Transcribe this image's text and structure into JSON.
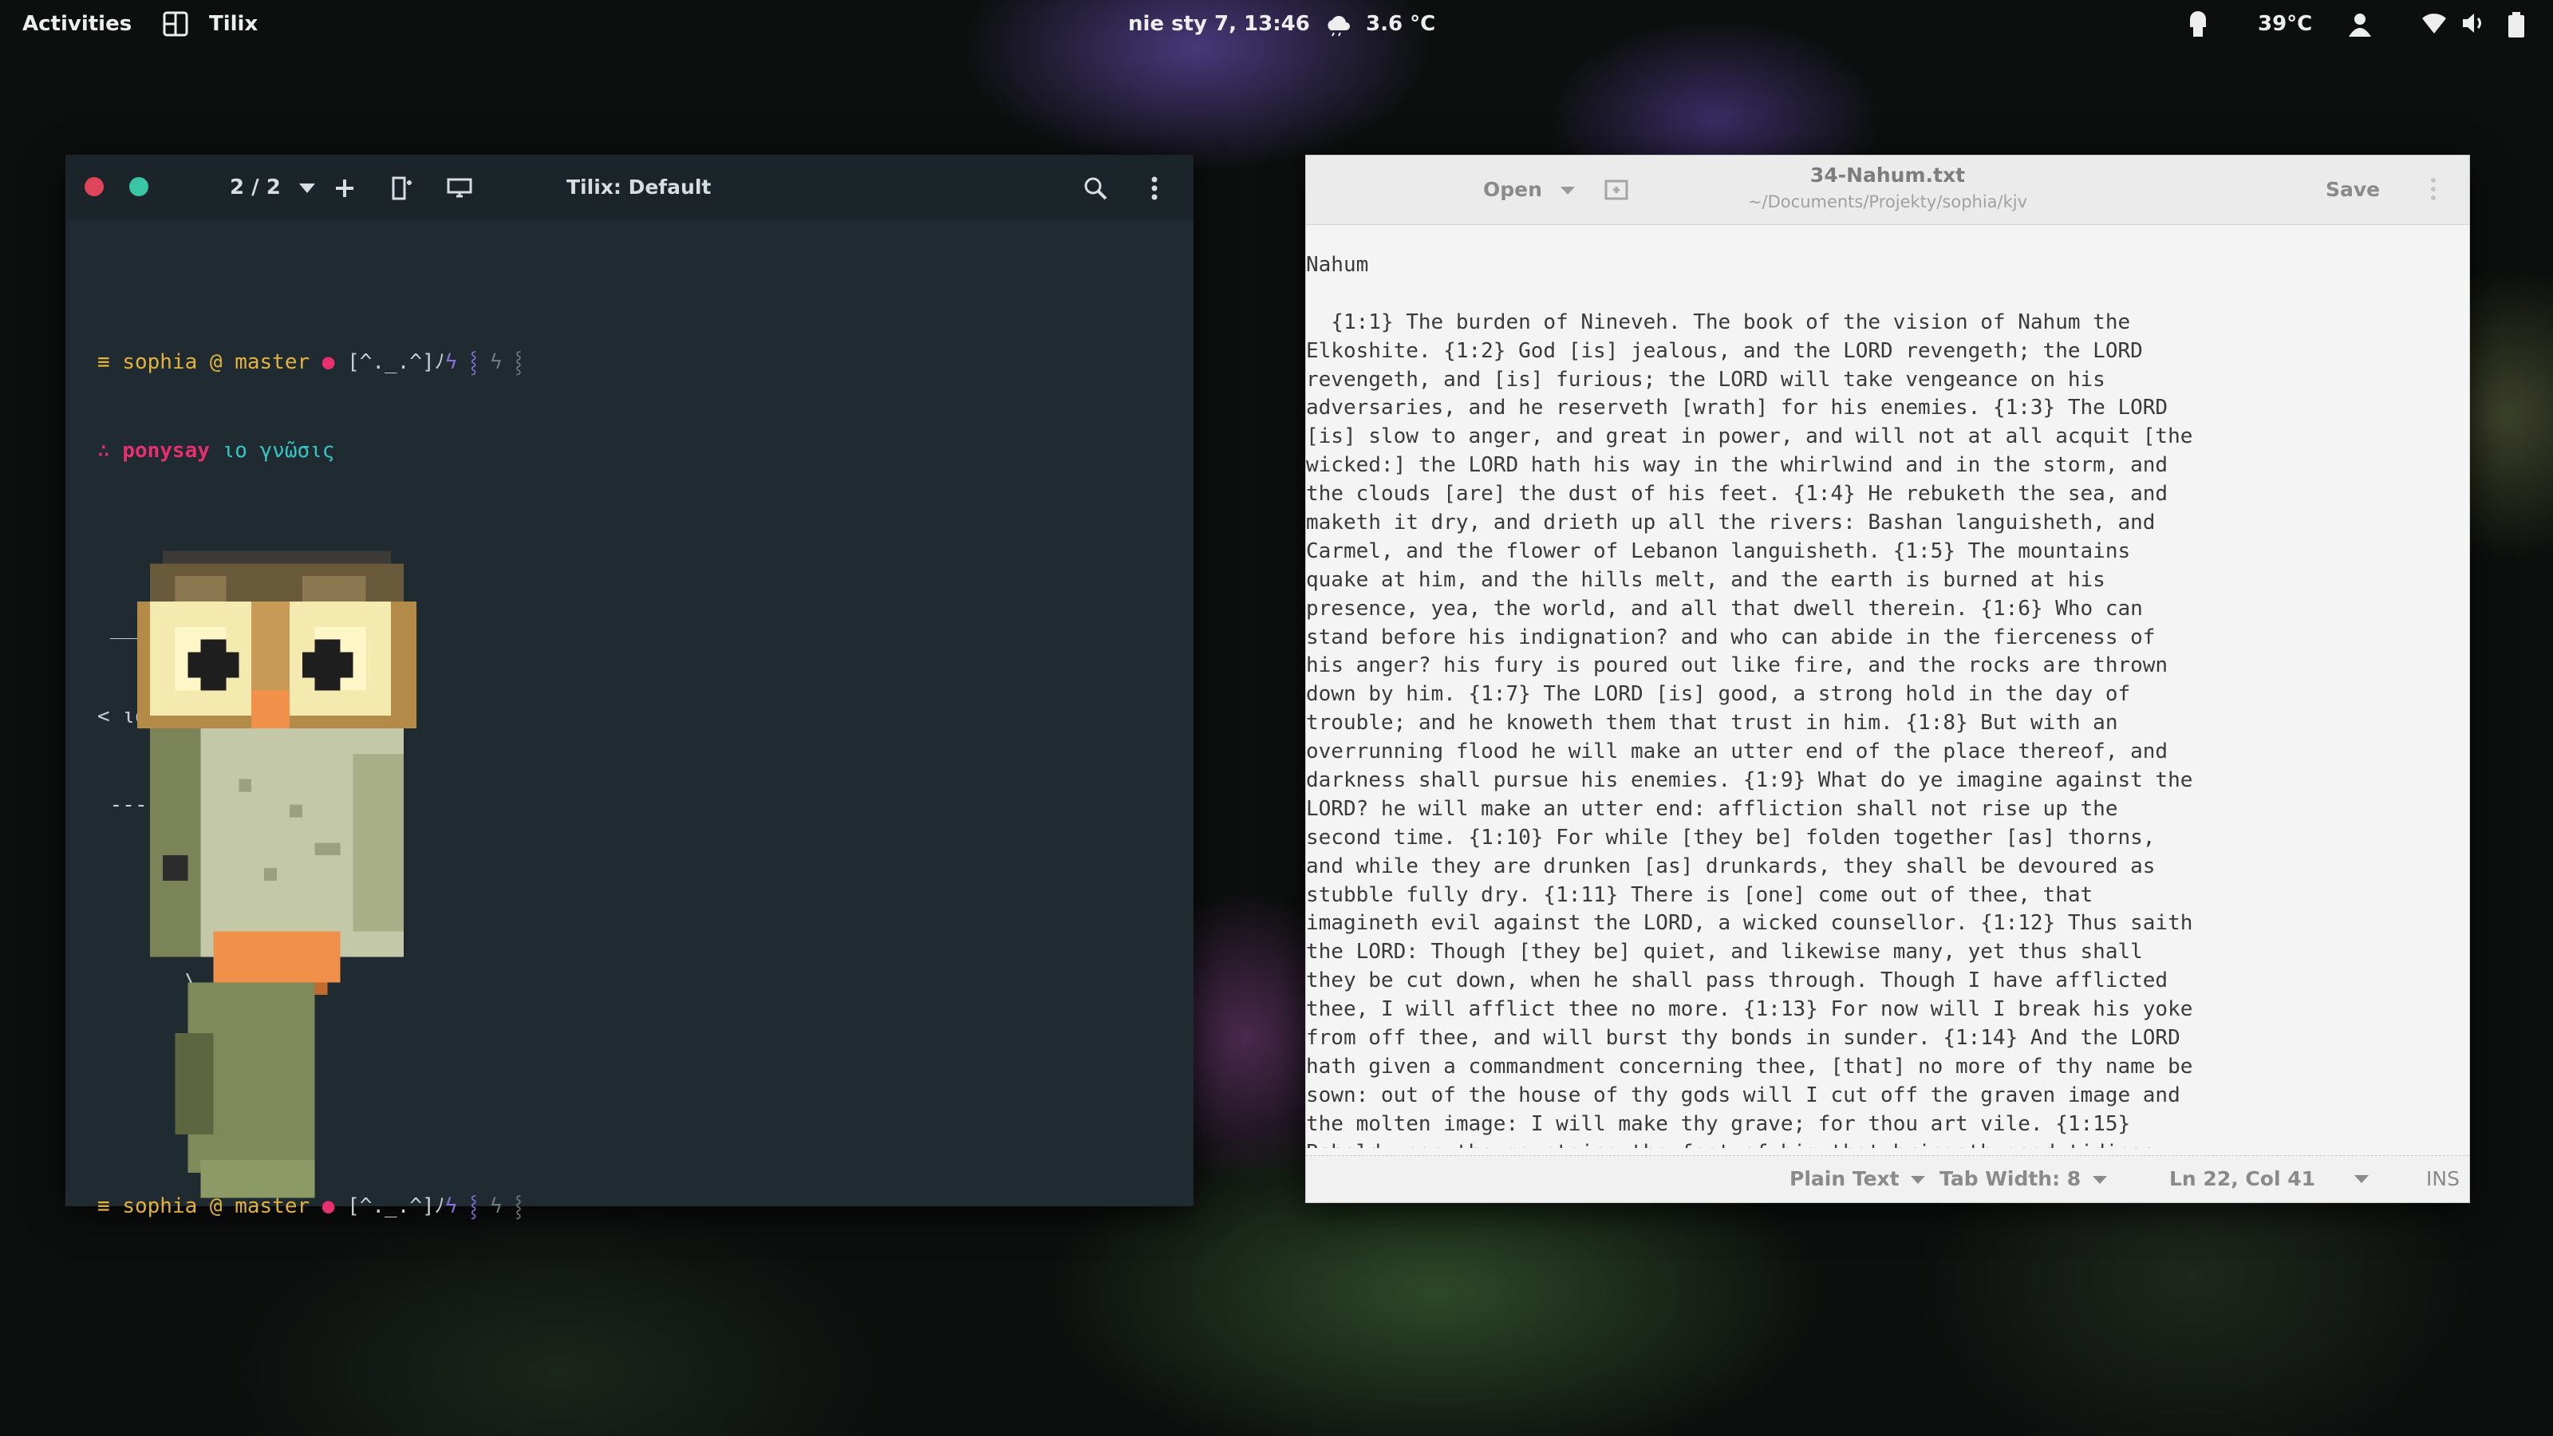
{
  "topbar": {
    "activities": "Activities",
    "app_name": "Tilix",
    "clock": "nie sty  7, 13:46",
    "weather": "3.6 °C",
    "temperature": "39°C"
  },
  "terminal": {
    "session_counter": "2 / 2",
    "title": "Tilix: Default",
    "prompt_user": "sophia",
    "prompt_at": "@",
    "prompt_branch": "master",
    "prompt_dot": "●",
    "prompt_face": "[^._.^]ﾉ",
    "command": "ponysay",
    "command_args": "ιο γνῶσις",
    "bubble_top": " ___________",
    "bubble_text": "< ιο γνῶσις >",
    "bubble_bottom": " -----------",
    "tail_1": "      \\",
    "tail_2": "       \\",
    "tail_3": "        \\",
    "menu_glyph": "≡",
    "cont_glyph": "∴"
  },
  "editor": {
    "open_label": "Open",
    "filename": "34-Nahum.txt",
    "path": "~/Documents/Projekty/sophia/kjv",
    "save_label": "Save",
    "text_lines": [
      "Nahum",
      "",
      "  {1:1} The burden of Nineveh. The book of the vision of Nahum the",
      "Elkoshite. {1:2} God [is] jealous, and the LORD revengeth; the LORD",
      "revengeth, and [is] furious; the LORD will take vengeance on his",
      "adversaries, and he reserveth [wrath] for his enemies. {1:3} The LORD",
      "[is] slow to anger, and great in power, and will not at all acquit [the",
      "wicked:] the LORD hath his way in the whirlwind and in the storm, and",
      "the clouds [are] the dust of his feet. {1:4} He rebuketh the sea, and",
      "maketh it dry, and drieth up all the rivers: Bashan languisheth, and",
      "Carmel, and the flower of Lebanon languisheth. {1:5} The mountains",
      "quake at him, and the hills melt, and the earth is burned at his",
      "presence, yea, the world, and all that dwell therein. {1:6} Who can",
      "stand before his indignation? and who can abide in the fierceness of",
      "his anger? his fury is poured out like fire, and the rocks are thrown",
      "down by him. {1:7} The LORD [is] good, a strong hold in the day of",
      "trouble; and he knoweth them that trust in him. {1:8} But with an",
      "overrunning flood he will make an utter end of the place thereof, and",
      "darkness shall pursue his enemies. {1:9} What do ye imagine against the",
      "LORD? he will make an utter end: affliction shall not rise up the",
      "second time. {1:10} For while [they be] folden together [as] thorns,",
      "and while they are drunken [as] drunkards, they shall be devoured as",
      "stubble fully dry. {1:11} There is [one] come out of thee, that",
      "imagineth evil against the LORD, a wicked counsellor. {1:12} Thus saith",
      "the LORD: Though [they be] quiet, and likewise many, yet thus shall",
      "they be cut down, when he shall pass through. Though I have afflicted",
      "thee, I will afflict thee no more. {1:13} For now will I break his yoke",
      "from off thee, and will burst thy bonds in sunder. {1:14} And the LORD",
      "hath given a commandment concerning thee, [that] no more of thy name be",
      "sown: out of the house of thy gods will I cut off the graven image and",
      "the molten image: I will make thy grave; for thou art vile. {1:15}",
      "Behold upon the mountains the feet of him that bringeth good tidings"
    ],
    "status": {
      "language": "Plain Text",
      "tab_width": "Tab Width: 8",
      "position": "Ln 22, Col 41",
      "mode": "INS"
    }
  },
  "colors": {
    "term_bg": "#1f2b31",
    "prompt_yellow": "#e3b23c",
    "prompt_pink": "#e8306e",
    "prompt_cyan": "#35c4c4",
    "close_red": "#e0445a",
    "max_teal": "#39c6a5"
  }
}
